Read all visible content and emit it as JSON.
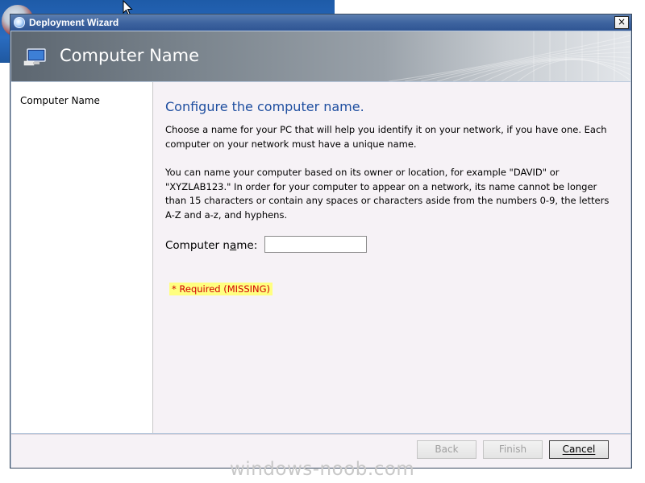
{
  "window": {
    "title": "Deployment Wizard",
    "close_glyph": "×"
  },
  "header": {
    "title": "Computer Name",
    "icon": "computer-monitor-icon"
  },
  "sidebar": {
    "items": [
      {
        "label": "Computer Name"
      }
    ]
  },
  "main": {
    "heading": "Configure the computer name.",
    "paragraph1": "Choose a name for your PC that will help you identify it on your network, if you have one. Each computer on your network must have a unique name.",
    "paragraph2": "You can name your computer based on its owner or location, for example \"DAVID\" or \"XYZLAB123.\" In order for your computer to appear on a network, its name cannot be longer than 15 characters or contain any spaces or characters aside from the numbers 0-9, the letters A-Z and a-z, and hyphens.",
    "field": {
      "label_pre": "Computer n",
      "label_accel": "a",
      "label_post": "me:",
      "value": "",
      "placeholder": ""
    },
    "required_note": "* Required (MISSING)"
  },
  "footer": {
    "back_label": "Back",
    "finish_label": "Finish",
    "cancel_label": "Cancel"
  },
  "watermark": "windows-noob.com",
  "colors": {
    "heading": "#1f4fa0",
    "required_text": "#d00000",
    "required_bg": "#ffff80",
    "titlebar": "#3e64a0"
  }
}
